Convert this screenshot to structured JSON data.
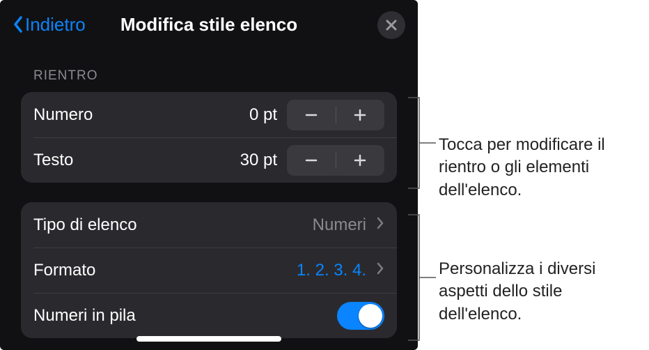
{
  "header": {
    "back_label": "Indietro",
    "title": "Modifica stile elenco"
  },
  "sections": {
    "rientro": {
      "header": "RIENTRO",
      "numero": {
        "label": "Numero",
        "value": "0 pt"
      },
      "testo": {
        "label": "Testo",
        "value": "30 pt"
      }
    },
    "style": {
      "tipo": {
        "label": "Tipo di elenco",
        "value": "Numeri"
      },
      "formato": {
        "label": "Formato",
        "value": "1. 2. 3. 4."
      },
      "pila": {
        "label": "Numeri in pila",
        "on": true
      }
    }
  },
  "callouts": {
    "c1": "Tocca per modificare il rientro o gli elementi dell'elenco.",
    "c2": "Personalizza i diversi aspetti dello stile dell'elenco."
  }
}
